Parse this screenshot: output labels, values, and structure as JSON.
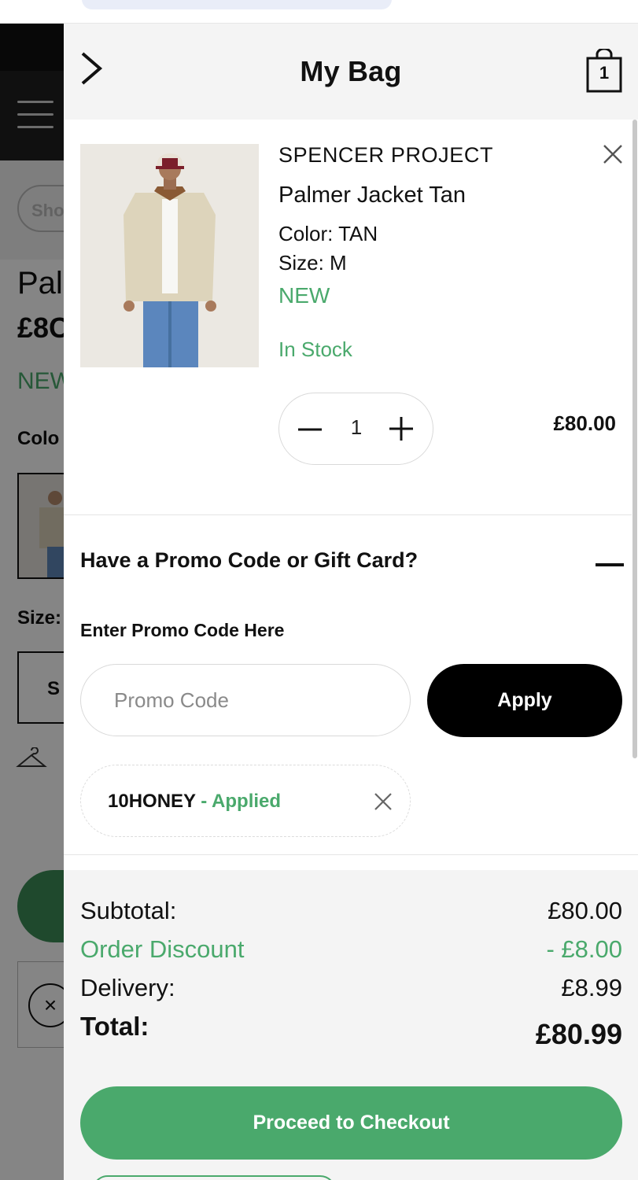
{
  "background_page": {
    "pill_label": "Sho",
    "title_fragment": "Pal",
    "price_fragment": "£8C",
    "new_fragment": "NEW",
    "color_label": "Colo",
    "size_label": "Size:",
    "size_option": "S"
  },
  "drawer": {
    "title": "My Bag",
    "bag_count": "1"
  },
  "item": {
    "brand": "SPENCER PROJECT",
    "name": "Palmer Jacket Tan",
    "color": "Color: TAN",
    "size": "Size: M",
    "badge": "NEW",
    "stock": "In Stock",
    "quantity": "1",
    "price": "£80.00"
  },
  "promo": {
    "heading": "Have a Promo Code or Gift Card?",
    "label": "Enter Promo Code Here",
    "placeholder": "Promo Code",
    "apply_label": "Apply",
    "applied_code": "10HONEY",
    "applied_status": " - Applied"
  },
  "summary": {
    "subtotal_label": "Subtotal:",
    "subtotal_value": "£80.00",
    "discount_label": "Order Discount",
    "discount_value": "- £8.00",
    "delivery_label": "Delivery:",
    "delivery_value": "£8.99",
    "total_label": "Total:",
    "total_value": "£80.99",
    "checkout_label": "Proceed to Checkout"
  },
  "colors": {
    "accent_green": "#4aa96c",
    "primary_black": "#000000",
    "header_gray": "#f4f4f4"
  },
  "icons": [
    "chevron-right-icon",
    "shopping-bag-icon",
    "close-icon",
    "minus-icon",
    "plus-icon",
    "hamburger-icon",
    "hanger-icon"
  ]
}
